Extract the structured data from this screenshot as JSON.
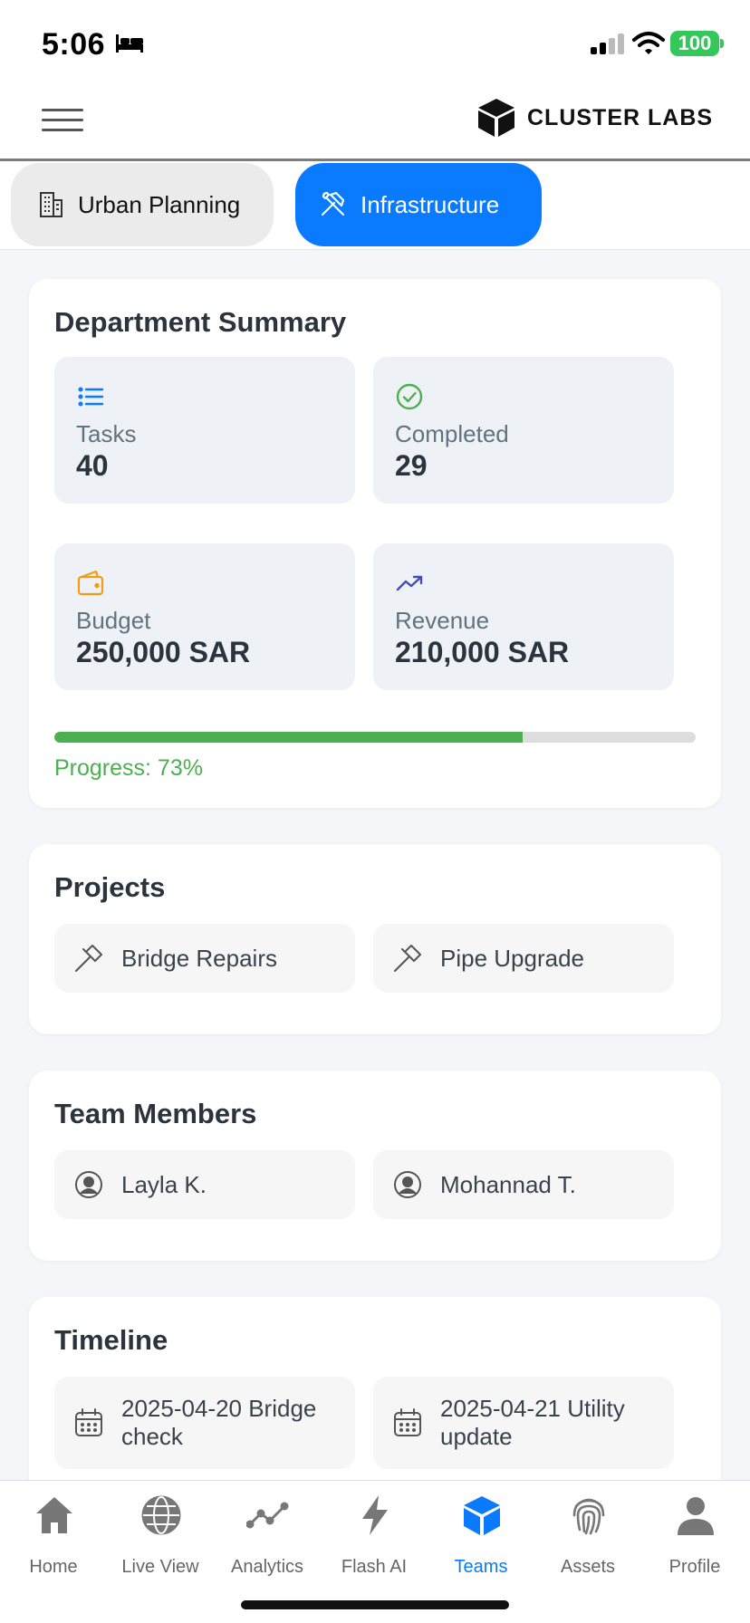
{
  "status_bar": {
    "time": "5:06",
    "battery": "100"
  },
  "header": {
    "brand": "CLUSTER LABS"
  },
  "dept_tabs": [
    {
      "label": "Urban Planning",
      "icon": "building-icon",
      "active": false
    },
    {
      "label": "Infrastructure",
      "icon": "tools-icon",
      "active": true
    }
  ],
  "summary": {
    "title": "Department Summary",
    "tasks": {
      "label": "Tasks",
      "value": "40"
    },
    "completed": {
      "label": "Completed",
      "value": "29"
    },
    "budget": {
      "label": "Budget",
      "value": "250,000 SAR"
    },
    "revenue": {
      "label": "Revenue",
      "value": "210,000 SAR"
    },
    "progress_percent": 73,
    "progress_label": "Progress: 73%"
  },
  "projects": {
    "title": "Projects",
    "items": [
      {
        "label": "Bridge Repairs"
      },
      {
        "label": "Pipe Upgrade"
      }
    ]
  },
  "team": {
    "title": "Team Members",
    "items": [
      {
        "label": "Layla K."
      },
      {
        "label": "Mohannad T."
      }
    ]
  },
  "timeline": {
    "title": "Timeline",
    "items": [
      {
        "label": "2025-04-20 Bridge check"
      },
      {
        "label": "2025-04-21 Utility update"
      }
    ]
  },
  "bottom_nav": [
    {
      "label": "Home",
      "icon": "home-icon"
    },
    {
      "label": "Live View",
      "icon": "globe-icon"
    },
    {
      "label": "Analytics",
      "icon": "analytics-icon"
    },
    {
      "label": "Flash AI",
      "icon": "lightning-icon"
    },
    {
      "label": "Teams",
      "icon": "cube-icon",
      "active": true
    },
    {
      "label": "Assets",
      "icon": "fingerprint-icon"
    },
    {
      "label": "Profile",
      "icon": "person-icon"
    }
  ],
  "colors": {
    "accent": "#0a7aff",
    "progress": "#4caf50",
    "battery": "#34c759",
    "budget_icon": "#f39c12",
    "revenue_icon": "#3f51b5",
    "completed_icon": "#4caf50"
  }
}
